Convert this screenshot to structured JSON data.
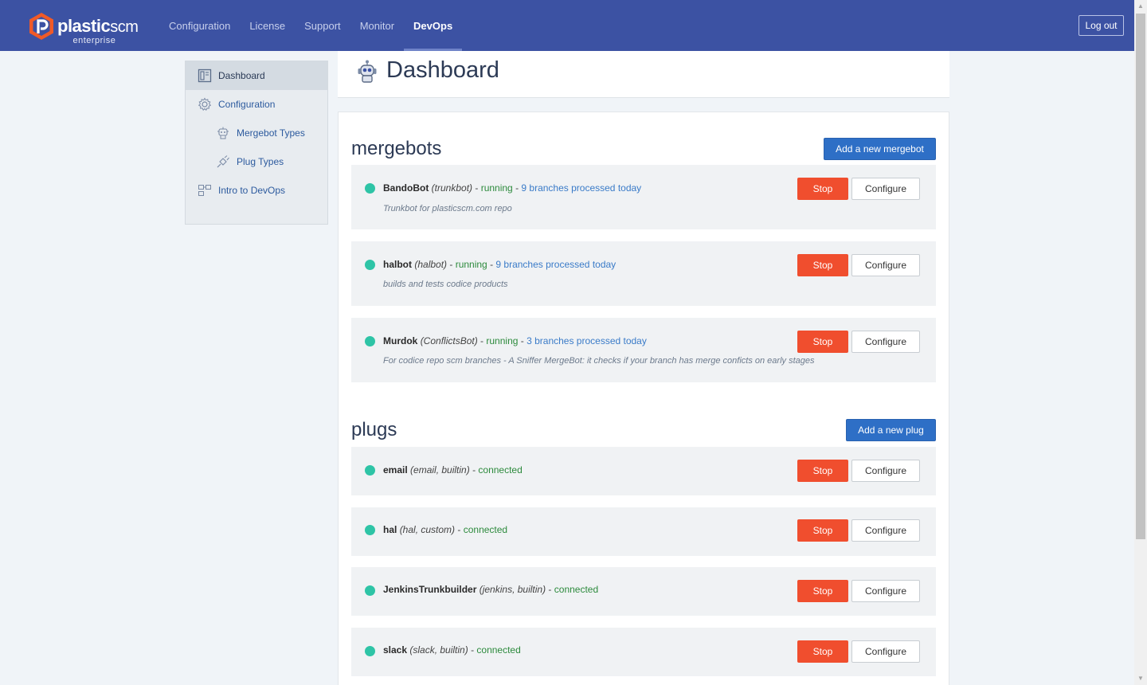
{
  "app": {
    "logo_main": "plastic",
    "logo_scm": "scm",
    "logo_sub": "enterprise"
  },
  "nav": {
    "items": [
      {
        "label": "Configuration"
      },
      {
        "label": "License"
      },
      {
        "label": "Support"
      },
      {
        "label": "Monitor"
      },
      {
        "label": "DevOps"
      }
    ],
    "active": "DevOps",
    "logout_label": "Log out"
  },
  "sidebar": {
    "items": [
      {
        "label": "Dashboard",
        "icon": "dashboard-icon"
      },
      {
        "label": "Configuration",
        "icon": "gear-icon"
      },
      {
        "label": "Mergebot Types",
        "icon": "robot-icon"
      },
      {
        "label": "Plug Types",
        "icon": "plug-icon"
      },
      {
        "label": "Intro to DevOps",
        "icon": "blocks-icon"
      }
    ]
  },
  "header": {
    "title": "Dashboard"
  },
  "mergebots": {
    "title": "mergebots",
    "add_label": "Add a new mergebot",
    "items": [
      {
        "name": "BandoBot",
        "type": "(trunkbot)",
        "sep1": " - ",
        "status": "running",
        "sep2": " - ",
        "link": "9 branches processed today",
        "desc": "Trunkbot for plasticscm.com repo",
        "stop": "Stop",
        "configure": "Configure"
      },
      {
        "name": "halbot",
        "type": "(halbot)",
        "sep1": " - ",
        "status": "running",
        "sep2": " - ",
        "link": "9 branches processed today",
        "desc": "builds and tests codice products",
        "stop": "Stop",
        "configure": "Configure"
      },
      {
        "name": "Murdok",
        "type": "(ConflictsBot)",
        "sep1": " - ",
        "status": "running",
        "sep2": " - ",
        "link": "3 branches processed today",
        "desc": "For codice repo scm branches - A Sniffer MergeBot: it checks if your branch has merge conficts on early stages",
        "stop": "Stop",
        "configure": "Configure"
      }
    ]
  },
  "plugs": {
    "title": "plugs",
    "add_label": "Add a new plug",
    "items": [
      {
        "name": "email",
        "type": "(email, builtin)",
        "sep1": " - ",
        "status": "connected",
        "stop": "Stop",
        "configure": "Configure"
      },
      {
        "name": "hal",
        "type": "(hal, custom)",
        "sep1": " - ",
        "status": "connected",
        "stop": "Stop",
        "configure": "Configure"
      },
      {
        "name": "JenkinsTrunkbuilder",
        "type": "(jenkins, builtin)",
        "sep1": " - ",
        "status": "connected",
        "stop": "Stop",
        "configure": "Configure"
      },
      {
        "name": "slack",
        "type": "(slack, builtin)",
        "sep1": " - ",
        "status": "connected",
        "stop": "Stop",
        "configure": "Configure"
      }
    ]
  },
  "colors": {
    "topbar": "#3c52a3",
    "accent": "#2e6fc6",
    "stop": "#f04e2e",
    "status_dot": "#2ec4a6"
  }
}
